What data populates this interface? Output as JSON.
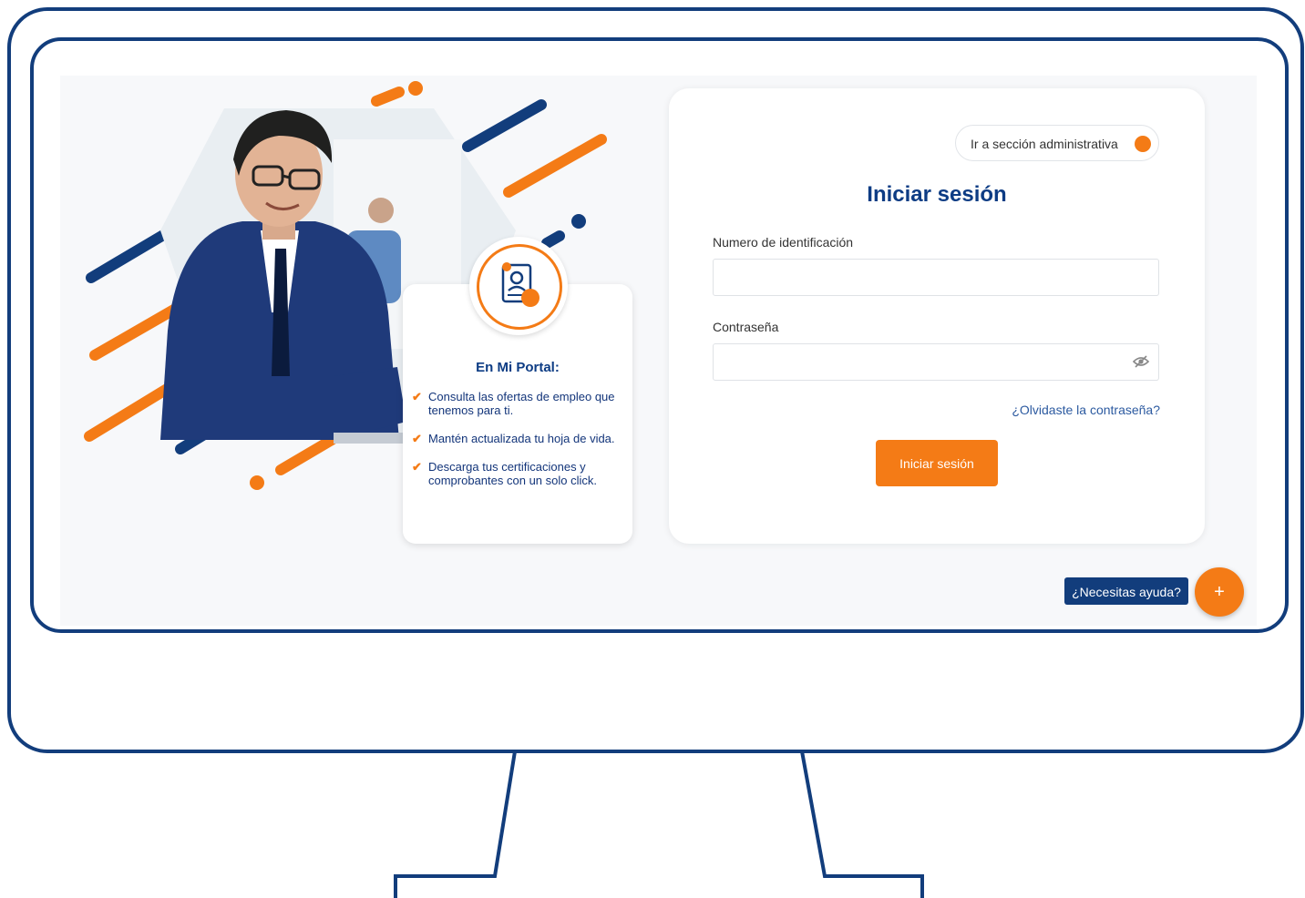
{
  "portal": {
    "title": "En Mi Portal:",
    "items": [
      "Consulta las ofertas de empleo que tenemos para ti.",
      "Mantén actualizada tu hoja de vida.",
      "Descarga tus certificaciones y comprobantes con un solo click."
    ]
  },
  "login": {
    "admin_toggle_label": "Ir a sección administrativa",
    "title": "Iniciar sesión",
    "id_label": "Numero de identificación",
    "id_value": "",
    "password_label": "Contraseña",
    "password_value": "",
    "forgot_link": "¿Olvidaste la contraseña?",
    "submit_label": "Iniciar sesión"
  },
  "help": {
    "label": "¿Necesitas ayuda?",
    "fab_icon": "+"
  },
  "colors": {
    "brand_blue": "#0d3c84",
    "brand_orange": "#f47b16",
    "frame_blue": "#123d7c"
  }
}
